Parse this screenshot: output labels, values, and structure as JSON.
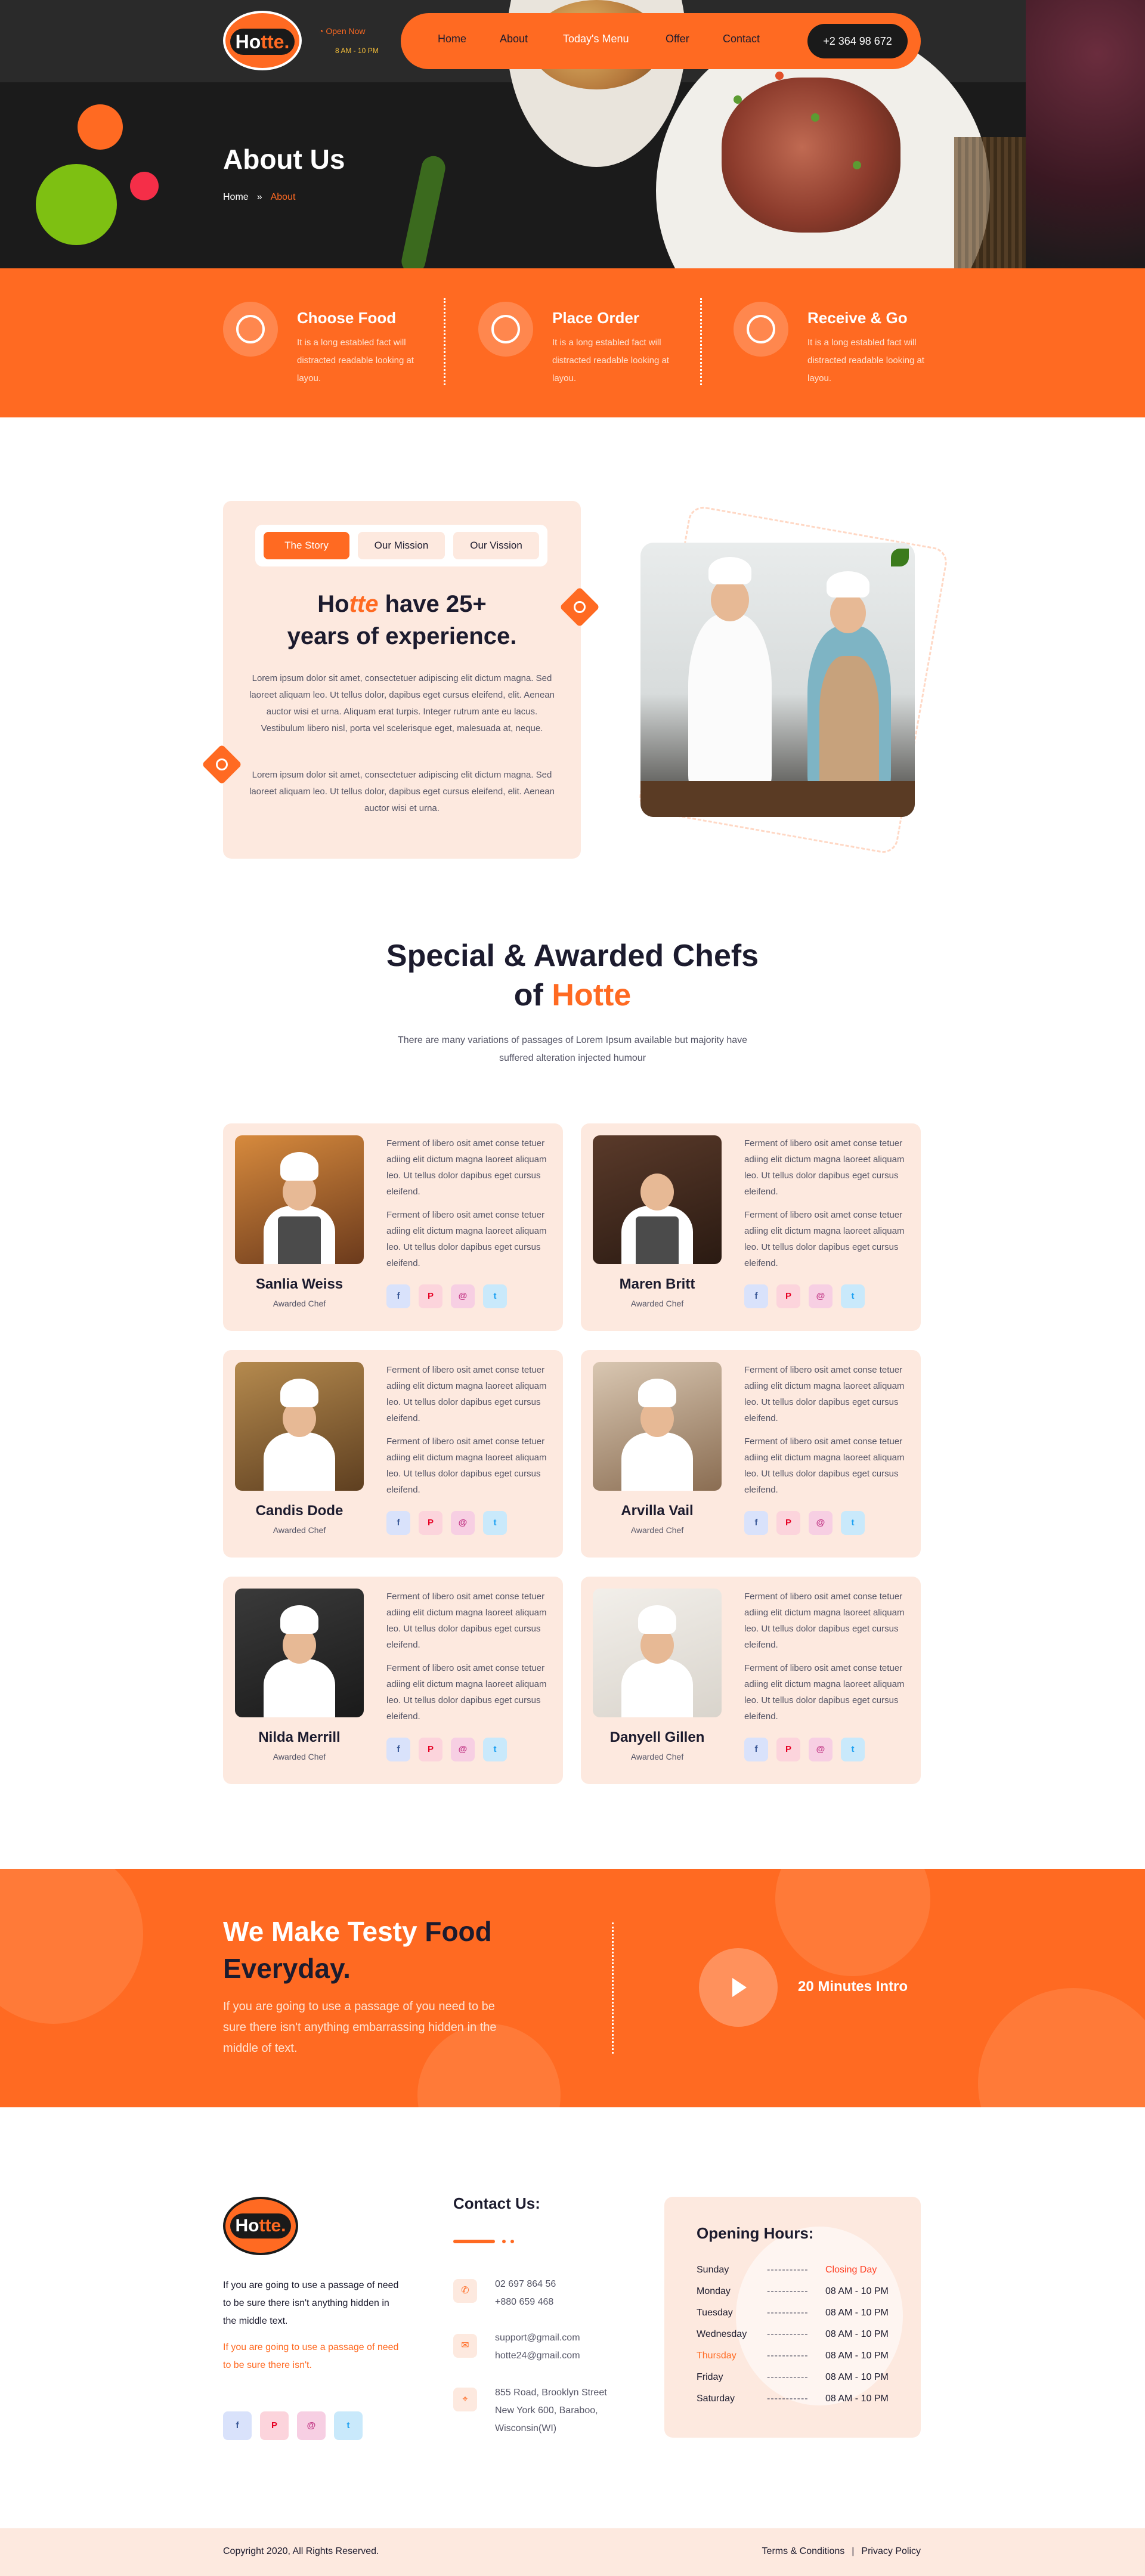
{
  "header": {
    "logo_text_a": "Ho",
    "logo_text_b": "tte.",
    "open_label": "Open Now",
    "open_hours": "8 AM - 10 PM",
    "nav": [
      "Home",
      "About",
      "Today's Menu",
      "Offer",
      "Contact"
    ],
    "active_nav": "Today's Menu",
    "phone": "+2 364 98 672"
  },
  "hero": {
    "title": "About Us",
    "breadcrumb": [
      "Home",
      "»",
      "About"
    ]
  },
  "features": [
    {
      "title": "Choose Food",
      "text": "It is a long establed fact will distracted readable looking at layou.",
      "icon": "food-tray-icon"
    },
    {
      "title": "Place Order",
      "text": "It is a long establed fact will distracted readable looking at layou.",
      "icon": "burger-icon"
    },
    {
      "title": "Receive & Go",
      "text": "It is a long establed fact will distracted readable looking at layou.",
      "icon": "plate-icon"
    }
  ],
  "story": {
    "tabs": [
      "The Story",
      "Our Mission",
      "Our Vission"
    ],
    "active_tab": "The Story",
    "heading_a": "Ho",
    "heading_b": "tte",
    "heading_c": " have 25+",
    "heading_line2": "years of experience.",
    "para1": "Lorem ipsum dolor sit amet, consectetuer adipiscing elit dictum magna. Sed laoreet aliquam leo. Ut tellus dolor, dapibus eget cursus eleifend, elit. Aenean auctor wisi et urna. Aliquam erat turpis. Integer rutrum ante eu lacus. Vestibulum libero nisl, porta vel scelerisque eget, malesuada at, neque.",
    "para2": "Lorem ipsum dolor sit amet, consectetuer adipiscing elit dictum magna. Sed laoreet aliquam leo. Ut tellus dolor, dapibus eget cursus eleifend, elit. Aenean auctor wisi et urna."
  },
  "chefs_section": {
    "title_line1": "Special & Awarded Chefs",
    "title_line2a": "of ",
    "title_line2b": "Hotte",
    "subtitle": "There are many variations of passages of Lorem Ipsum available but majority have suffered alteration injected humour"
  },
  "chefs": [
    {
      "name": "Sanlia Weiss",
      "role": "Awarded Chef",
      "p1": "Ferment of libero osit amet conse tetuer adiing elit dictum magna laoreet aliquam leo. Ut tellus dolor dapibus eget cursus eleifend.",
      "p2": "Ferment of libero osit amet conse tetuer adiing elit dictum magna laoreet aliquam leo. Ut tellus dolor dapibus eget cursus eleifend."
    },
    {
      "name": "Maren Britt",
      "role": "Awarded Chef",
      "p1": "Ferment of libero osit amet conse tetuer adiing elit dictum magna laoreet aliquam leo. Ut tellus dolor dapibus eget cursus eleifend.",
      "p2": "Ferment of libero osit amet conse tetuer adiing elit dictum magna laoreet aliquam leo. Ut tellus dolor dapibus eget cursus eleifend."
    },
    {
      "name": "Candis Dode",
      "role": "Awarded Chef",
      "p1": "Ferment of libero osit amet conse tetuer adiing elit dictum magna laoreet aliquam leo. Ut tellus dolor dapibus eget cursus eleifend.",
      "p2": "Ferment of libero osit amet conse tetuer adiing elit dictum magna laoreet aliquam leo. Ut tellus dolor dapibus eget cursus eleifend."
    },
    {
      "name": "Arvilla Vail",
      "role": "Awarded Chef",
      "p1": "Ferment of libero osit amet conse tetuer adiing elit dictum magna laoreet aliquam leo. Ut tellus dolor dapibus eget cursus eleifend.",
      "p2": "Ferment of libero osit amet conse tetuer adiing elit dictum magna laoreet aliquam leo. Ut tellus dolor dapibus eget cursus eleifend."
    },
    {
      "name": "Nilda Merrill",
      "role": "Awarded Chef",
      "p1": "Ferment of libero osit amet conse tetuer adiing elit dictum magna laoreet aliquam leo. Ut tellus dolor dapibus eget cursus eleifend.",
      "p2": "Ferment of libero osit amet conse tetuer adiing elit dictum magna laoreet aliquam leo. Ut tellus dolor dapibus eget cursus eleifend."
    },
    {
      "name": "Danyell Gillen",
      "role": "Awarded Chef",
      "p1": "Ferment of libero osit amet conse tetuer adiing elit dictum magna laoreet aliquam leo. Ut tellus dolor dapibus eget cursus eleifend.",
      "p2": "Ferment of libero osit amet conse tetuer adiing elit dictum magna laoreet aliquam leo. Ut tellus dolor dapibus eget cursus eleifend."
    }
  ],
  "social_icons": {
    "facebook": "f",
    "pinterest": "P",
    "instagram": "@",
    "twitter": "t"
  },
  "cta": {
    "title_a": "We Make Testy ",
    "title_b": "Food",
    "title_c": "Everyday.",
    "text": "If you are going to use a passage of you need to be sure there isn't anything embarrassing hidden in the middle of text.",
    "video_label": "20 Minutes Intro"
  },
  "footer": {
    "about1": "If you are going to use a passage of need to be sure there isn't anything hidden in the middle text.",
    "about2": "If you are going to use a passage of need to be sure there isn't.",
    "contact_title": "Contact Us:",
    "phone1": "02 697 864 56",
    "phone2": "+880 659 468",
    "email1": "support@gmail.com",
    "email2": "hotte24@gmail.com",
    "addr1": "855 Road, Brooklyn Street",
    "addr2": "New York 600, Baraboo,",
    "addr3": "Wisconsin(WI)",
    "hours_title": "Opening Hours:",
    "hours": [
      {
        "day": "Sunday",
        "dash": "-----------",
        "time": "Closing Day"
      },
      {
        "day": "Monday",
        "dash": "-----------",
        "time": "08 AM - 10 PM"
      },
      {
        "day": "Tuesday",
        "dash": "-----------",
        "time": "08 AM - 10 PM"
      },
      {
        "day": "Wednesday",
        "dash": "-----------",
        "time": "08 AM - 10 PM"
      },
      {
        "day": "Thursday",
        "dash": "-----------",
        "time": "08 AM - 10 PM"
      },
      {
        "day": "Friday",
        "dash": "-----------",
        "time": "08 AM - 10 PM"
      },
      {
        "day": "Saturday",
        "dash": "-----------",
        "time": "08 AM - 10 PM"
      }
    ],
    "copyright": "Copyright 2020, All Rights Reserved.",
    "terms": "Terms & Conditions",
    "sep": "|",
    "privacy": "Privacy Policy"
  },
  "colors": {
    "accent": "#ff6a22",
    "dark": "#1c1b2e",
    "cream": "#fde9df"
  }
}
